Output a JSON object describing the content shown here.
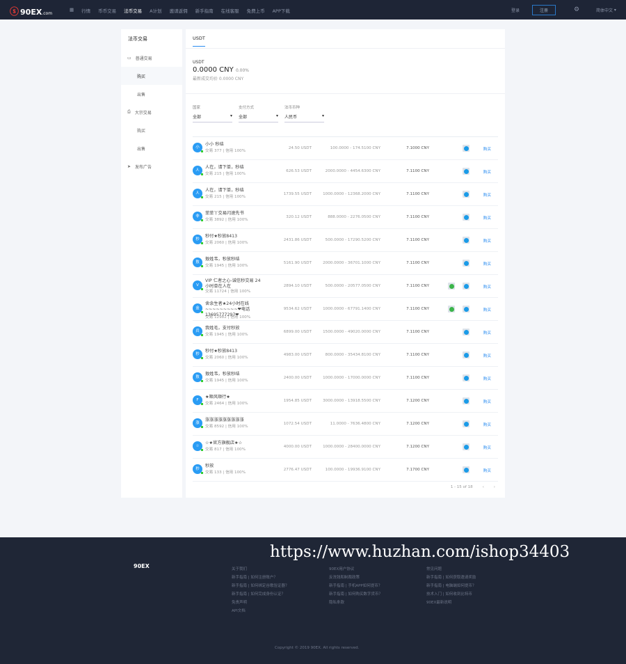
{
  "header": {
    "logo": "90EX",
    "logo_suffix": ".com",
    "nav": [
      "行情",
      "币币交易",
      "法币交易",
      "A计划",
      "邀请返佣",
      "新手指南",
      "在线客服",
      "免费上币",
      "APP下载"
    ],
    "active": 2,
    "login": "登录",
    "register": "注册",
    "language": "简体中文"
  },
  "sidebar": {
    "title": "法币交易",
    "groups": [
      {
        "label": "普通交易",
        "icon": "card-icon",
        "items": [
          "购买",
          "出售"
        ]
      },
      {
        "label": "大宗交易",
        "icon": "printer-icon",
        "items": [
          "购买",
          "出售"
        ]
      }
    ],
    "publish": "发布广告"
  },
  "main": {
    "tab": "USDT",
    "summary": {
      "coin": "USDT",
      "price": "0.0000 CNY",
      "change": "0.00%",
      "last": "最新成交均价 0.0000 CNY"
    },
    "filters": [
      {
        "label": "国家",
        "value": "全部"
      },
      {
        "label": "支付方式",
        "value": "全部"
      },
      {
        "label": "法币币种",
        "value": "人民币"
      }
    ],
    "buy_label": "购买",
    "rows": [
      {
        "av": "小",
        "name": "小小 秒结",
        "stats": "交易 377 | 信用 100%",
        "amount": "24.50 USDT",
        "limit": "100.0000 - 174.5100 CNY",
        "price": "7.1000 CNY",
        "wechat": false
      },
      {
        "av": "人",
        "name": "人在，请下单，秒结",
        "stats": "交易 215 | 信用 100%",
        "amount": "626.53 USDT",
        "limit": "2000.0000 - 4454.6300 CNY",
        "price": "7.1100 CNY",
        "wechat": false
      },
      {
        "av": "人",
        "name": "人在，请下单，秒结",
        "stats": "交易 215 | 信用 100%",
        "amount": "1739.55 USDT",
        "limit": "1000.0000 - 12368.2000 CNY",
        "price": "7.1100 CNY",
        "wechat": false
      },
      {
        "av": "非",
        "name": "菲菲丫交易闪速先书",
        "stats": "交易 3892 | 信用 100%",
        "amount": "320.12 USDT",
        "limit": "888.0000 - 2276.0500 CNY",
        "price": "7.1100 CNY",
        "wechat": false
      },
      {
        "av": "秒",
        "name": "秒付★秒放8413",
        "stats": "交易 2060 | 信用 100%",
        "amount": "2431.86 USDT",
        "limit": "500.0000 - 17290.5200 CNY",
        "price": "7.1100 CNY",
        "wechat": false
      },
      {
        "av": "敖",
        "name": "敖姓韦，秒放秒结",
        "stats": "交易 1945 | 信用 100%",
        "amount": "5161.90 USDT",
        "limit": "2000.0000 - 36701.1000 CNY",
        "price": "7.1100 CNY",
        "wechat": false
      },
      {
        "av": "V",
        "name": "VIP 仁者之心-诚信秒交易 24小时单在人在",
        "stats": "交易 11724 | 信用 100%",
        "amount": "2894.10 USDT",
        "limit": "500.0000 - 20577.0500 CNY",
        "price": "7.1100 CNY",
        "wechat": true
      },
      {
        "av": "金",
        "name": "舍余生者★24小时在线~~~~~~~~~❤电话13695777297❤",
        "stats": "交易 12982 | 信用 100%",
        "amount": "9534.62 USDT",
        "limit": "1000.0000 - 67791.1400 CNY",
        "price": "7.1100 CNY",
        "wechat": true
      },
      {
        "av": "兵",
        "name": "我姓毛，支付秒放",
        "stats": "交易 1945 | 信用 100%",
        "amount": "6899.00 USDT",
        "limit": "1500.0000 - 49020.0000 CNY",
        "price": "7.1100 CNY",
        "wechat": false
      },
      {
        "av": "秒",
        "name": "秒付★秒放8413",
        "stats": "交易 2060 | 信用 100%",
        "amount": "4983.00 USDT",
        "limit": "800.0000 - 35434.8100 CNY",
        "price": "7.1100 CNY",
        "wechat": false
      },
      {
        "av": "敖",
        "name": "敖姓韦，秒放秒结",
        "stats": "交易 1945 | 信用 100%",
        "amount": "2400.00 USDT",
        "limit": "1000.0000 - 17000.0000 CNY",
        "price": "7.1100 CNY",
        "wechat": false
      },
      {
        "av": "F",
        "name": "★顺风顺行★",
        "stats": "交易 2464 | 信用 100%",
        "amount": "1954.85 USDT",
        "limit": "3000.0000 - 13918.5500 CNY",
        "price": "7.1200 CNY",
        "wechat": false
      },
      {
        "av": "涨",
        "name": "涨涨涨涨涨涨涨涨涨",
        "stats": "交易 8592 | 信用 100%",
        "amount": "1072.54 USDT",
        "limit": "11.0000 - 7636.4800 CNY",
        "price": "7.1200 CNY",
        "wechat": false
      },
      {
        "av": "☆",
        "name": "☆★官方旗舰店★☆",
        "stats": "交易 817 | 信用 100%",
        "amount": "4000.00 USDT",
        "limit": "1000.0000 - 28400.0000 CNY",
        "price": "7.1200 CNY",
        "wechat": false
      },
      {
        "av": "秒",
        "name": "秒放",
        "stats": "交易 133 | 信用 100%",
        "amount": "2776.47 USDT",
        "limit": "100.0000 - 19936.9100 CNY",
        "price": "7.1700 CNY",
        "wechat": false
      }
    ],
    "pagination": "1 - 15 of 18"
  },
  "footer": {
    "watermark": "https://www.huzhan.com/ishop34403",
    "logo": "90EX",
    "columns": [
      [
        "关于我们",
        "新手指南 | 如何注册账户？",
        "新手指南 | 如何绑定谷歌验证器？",
        "新手指南 | 如何完成身份认证？",
        "免责声明",
        "API文档"
      ],
      [
        "90EX用户协议",
        "反洗钱和制裁政策",
        "新手指南 | 手机APP如何提币？",
        "新手指南 | 如何购买数字货币？",
        "隐私条款"
      ],
      [
        "常见问题",
        "新手指南 | 如何获取邀请奖励",
        "新手指南 | 电脑端如何提币？",
        "技术入门 | 如何收到比特币",
        "90EX最新说明"
      ]
    ],
    "copyright": "Copyright © 2019 90EX. All rights reserved."
  },
  "colors": {
    "header_bg": "#1e2536",
    "accent": "#2a8cf0",
    "wechat": "#3bb54a"
  }
}
